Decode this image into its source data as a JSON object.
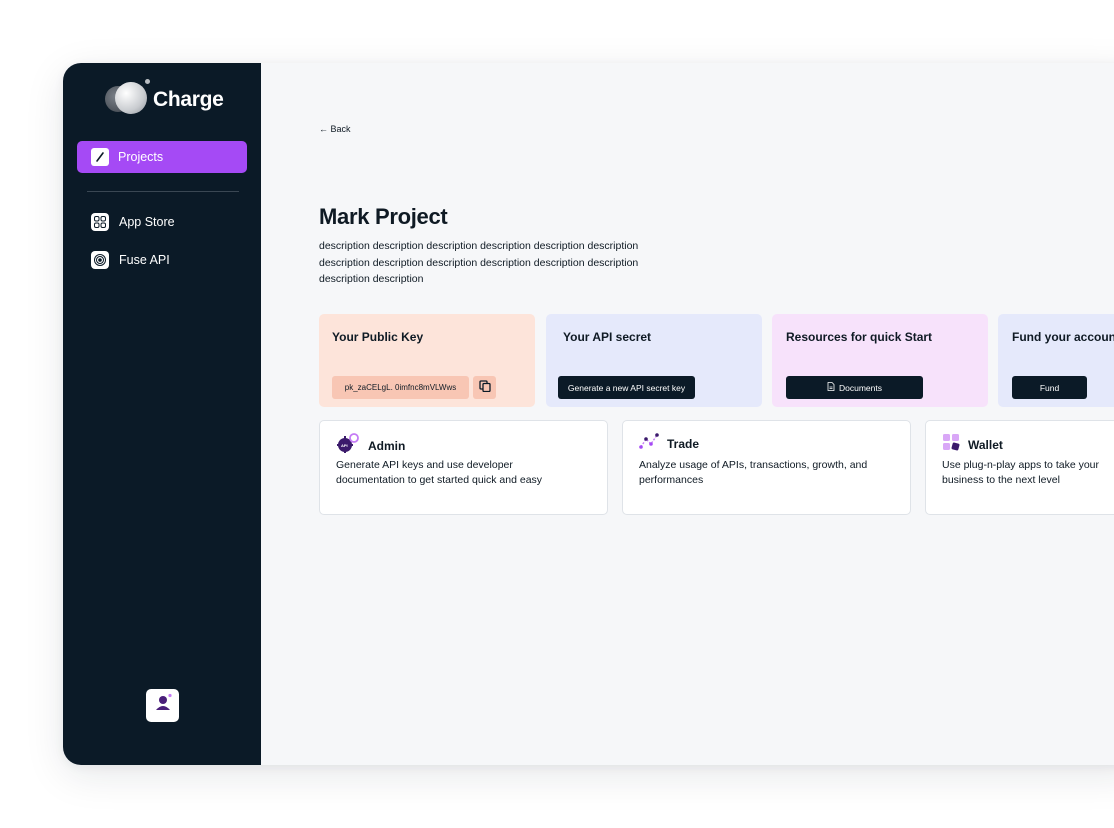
{
  "app": {
    "name": "Charge"
  },
  "sidebar": {
    "items": [
      {
        "label": "Projects",
        "icon": "pencil-icon",
        "active": true
      },
      {
        "label": "App Store",
        "icon": "grid-icon",
        "active": false
      },
      {
        "label": "Fuse API",
        "icon": "target-icon",
        "active": false
      }
    ],
    "avatar_icon": "user-icon"
  },
  "main": {
    "back_label": "← Back",
    "title": "Mark Project",
    "description": "description description description description description description description description description description description description description description",
    "cards": {
      "public_key": {
        "title": "Your Public Key",
        "value": "pk_zaCELgL. 0imfnc8mVLWws",
        "color": "#fde4da"
      },
      "api_secret": {
        "title": "Your API secret",
        "button": "Generate a new API secret key",
        "color": "#e5e9fb"
      },
      "resources": {
        "title": "Resources for quick Start",
        "button": "Documents",
        "color": "#f7e2fb"
      },
      "fund": {
        "title": "Fund your account",
        "button": "Fund",
        "color": "#e5e9fb"
      }
    },
    "features": [
      {
        "title": "Admin",
        "description": "Generate API keys and use developer documentation to get started quick and easy",
        "icon": "api-gear-icon"
      },
      {
        "title": "Trade",
        "description": "Analyze usage of APIs, transactions, growth, and performances",
        "icon": "chart-line-icon"
      },
      {
        "title": "Wallet",
        "description": "Use plug-n-play apps to take your business to the next level",
        "icon": "wallet-blocks-icon"
      }
    ]
  },
  "colors": {
    "sidebar_bg": "#0b1a27",
    "accent": "#a54af5",
    "dark_button": "#0b1a27"
  }
}
